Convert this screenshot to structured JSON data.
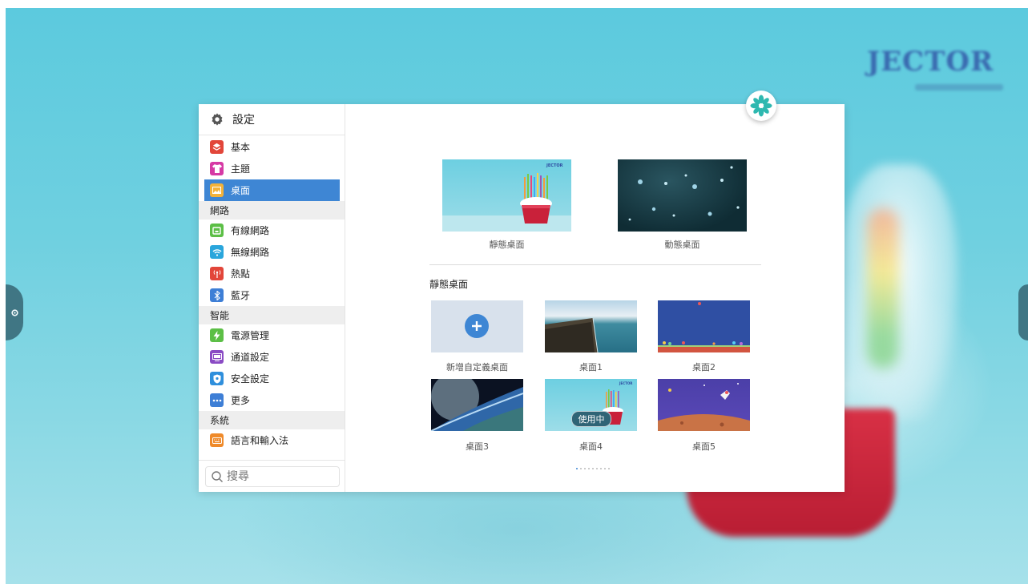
{
  "settings": {
    "title": "設定",
    "menu_basic": "基本",
    "menu_theme": "主題",
    "menu_desktop": "桌面",
    "section_network": "網路",
    "menu_wired": "有線網路",
    "menu_wireless": "無線網路",
    "menu_hotspot": "熱點",
    "menu_bluetooth": "藍牙",
    "section_smart": "智能",
    "menu_power": "電源管理",
    "menu_channel": "通道設定",
    "menu_security": "安全設定",
    "menu_more": "更多",
    "section_system": "系統",
    "menu_language": "語言和輸入法",
    "search_placeholder": "搜尋"
  },
  "desktop_panel": {
    "static_label": "靜態桌面",
    "dynamic_label": "動態桌面",
    "static_section_title": "靜態桌面",
    "add_custom_label": "新增自定義桌面",
    "wallpapers": [
      "桌面1",
      "桌面2",
      "桌面3",
      "桌面4",
      "桌面5"
    ],
    "in_use_badge": "使用中",
    "in_use_index": 4,
    "pager_pages": 9,
    "pager_current": 1
  },
  "colors": {
    "accent": "#3e86d4",
    "wallpaper_blue": "#5ccade",
    "badge": "#2f6476"
  },
  "icons": [
    "gear-icon",
    "layers-icon",
    "shirt-icon",
    "image-icon",
    "ethernet-icon",
    "wifi-icon",
    "hotspot-icon",
    "bluetooth-icon",
    "power-icon",
    "channel-icon",
    "shield-icon",
    "more-icon",
    "keyboard-icon",
    "search-icon",
    "plus-icon",
    "app-logo-icon"
  ]
}
